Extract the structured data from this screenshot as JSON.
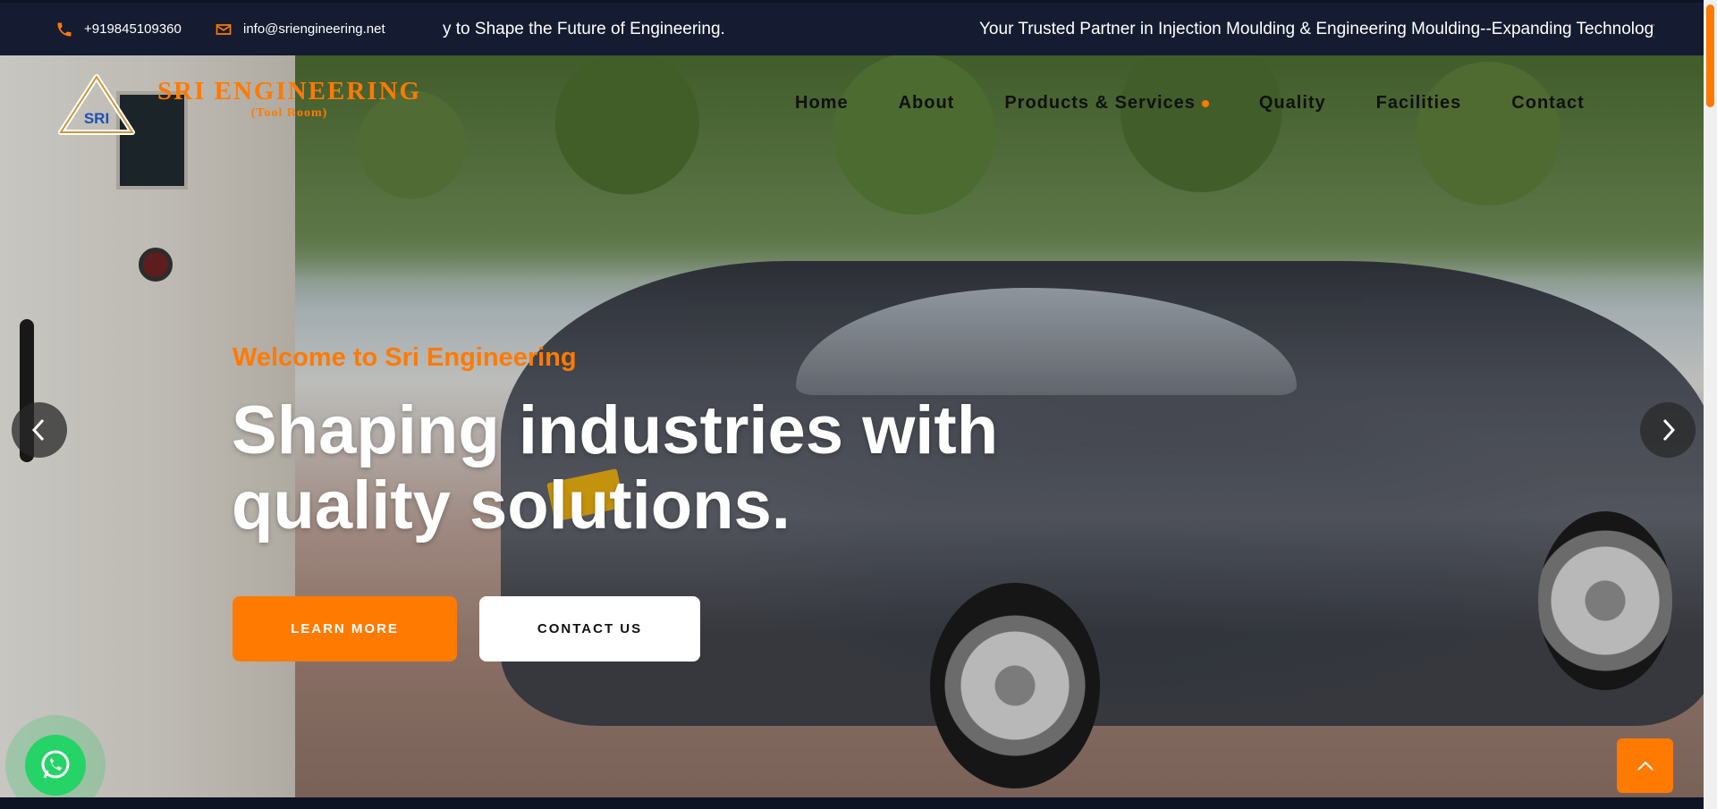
{
  "topbar": {
    "phone": "+919845109360",
    "email": "info@sriengineering.net",
    "ticker_1": "y to Shape the Future of Engineering.",
    "ticker_2": "Your Trusted Partner in Injection Moulding & Engineering Moulding--Expanding Technology"
  },
  "logo": {
    "mark_text": "SRI",
    "name": "SRI  ENGINEERING",
    "sub": "(Tool Room)"
  },
  "nav": {
    "items": [
      {
        "label": "Home"
      },
      {
        "label": "About"
      },
      {
        "label": "Products & Services"
      },
      {
        "label": "Quality"
      },
      {
        "label": "Facilities"
      },
      {
        "label": "Contact"
      }
    ]
  },
  "hero": {
    "welcome": "Welcome to Sri Engineering",
    "headline": "Shaping industries with quality solutions.",
    "learn_more": "LEARN MORE",
    "contact_us": "CONTACT US"
  },
  "colors": {
    "accent": "#ff7a00",
    "topbar_bg": "#151c31",
    "whatsapp": "#25d366"
  },
  "icons": {
    "phone": "phone-icon",
    "email": "envelope-icon",
    "prev": "chevron-left-icon",
    "next": "chevron-right-icon",
    "whatsapp": "whatsapp-icon",
    "to_top": "chevron-up-icon"
  }
}
